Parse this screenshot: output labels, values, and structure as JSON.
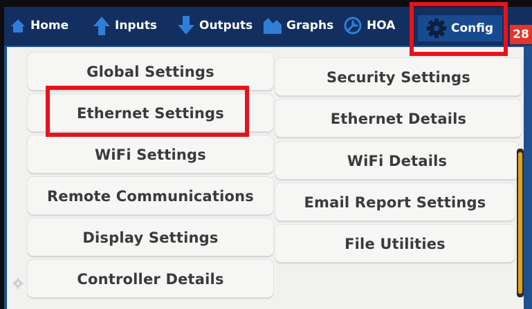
{
  "nav": {
    "tabs": [
      {
        "label": "Home",
        "icon": "home-icon"
      },
      {
        "label": "Inputs",
        "icon": "arrow-up-icon"
      },
      {
        "label": "Outputs",
        "icon": "arrow-down-icon"
      },
      {
        "label": "Graphs",
        "icon": "graph-icon"
      },
      {
        "label": "HOA",
        "icon": "wrench-icon"
      },
      {
        "label": "Config",
        "icon": "gear-icon"
      }
    ],
    "active_tab": "Config",
    "alarm_count": "28"
  },
  "menu": {
    "left": [
      "Global Settings",
      "Ethernet Settings",
      "WiFi Settings",
      "Remote Communications",
      "Display Settings",
      "Controller Details"
    ],
    "right": [
      "Security Settings",
      "Ethernet Details",
      "WiFi Details",
      "Email Report Settings",
      "File Utilities"
    ]
  },
  "colors": {
    "nav_bg": "#132f60",
    "active_tab_bg": "#184a8f",
    "highlight": "#e8121b",
    "badge": "#e5342b",
    "scroll_thumb": "#e0a21f"
  }
}
